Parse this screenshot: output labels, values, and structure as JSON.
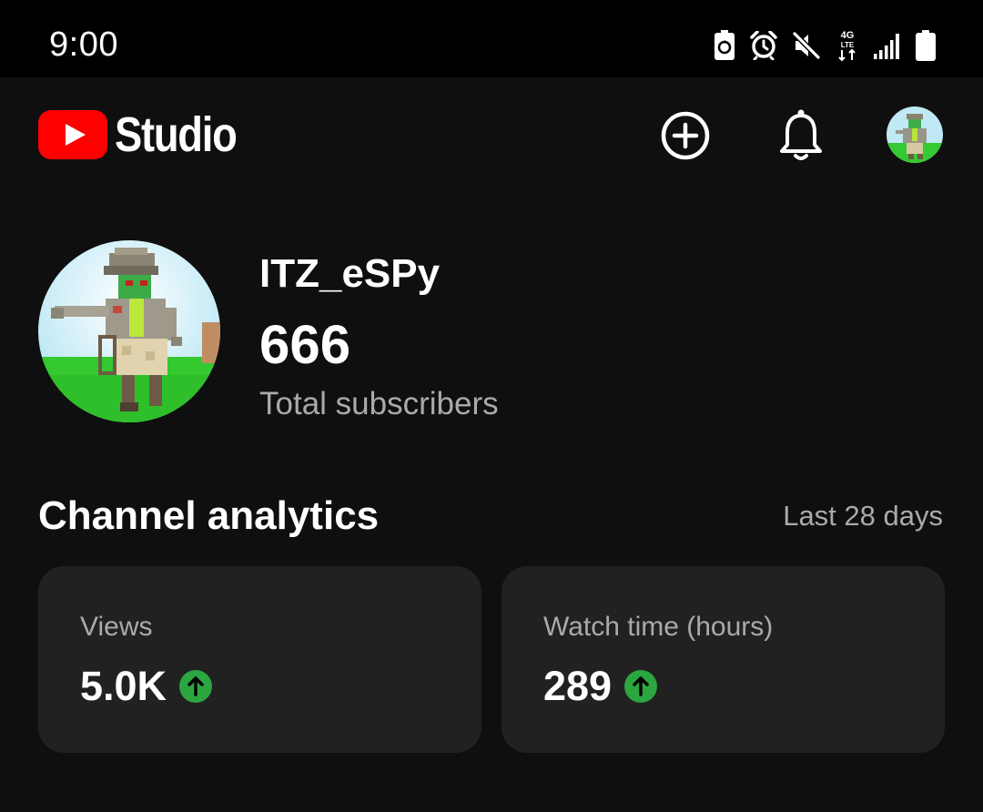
{
  "status_bar": {
    "time": "9:00",
    "icons": [
      "battery-saver-icon",
      "alarm-icon",
      "mute-icon",
      "4g-lte-icon",
      "signal-icon",
      "battery-icon"
    ]
  },
  "header": {
    "logo_text": "Studio",
    "icons": [
      "youtube-play-icon",
      "create-plus-icon",
      "notification-bell-icon"
    ],
    "colors": {
      "brand_red": "#ff0000",
      "background": "#0f0f0f"
    }
  },
  "channel": {
    "name": "ITZ_eSPy",
    "subscriber_count": "666",
    "subscriber_label": "Total subscribers"
  },
  "analytics": {
    "title": "Channel analytics",
    "period": "Last 28 days",
    "cards": [
      {
        "label": "Views",
        "value": "5.0K",
        "trend": "up"
      },
      {
        "label": "Watch time (hours)",
        "value": "289",
        "trend": "up"
      }
    ],
    "colors": {
      "trend_up": "#2ba640",
      "card_bg": "#212121",
      "secondary_text": "#aaaaaa"
    }
  }
}
